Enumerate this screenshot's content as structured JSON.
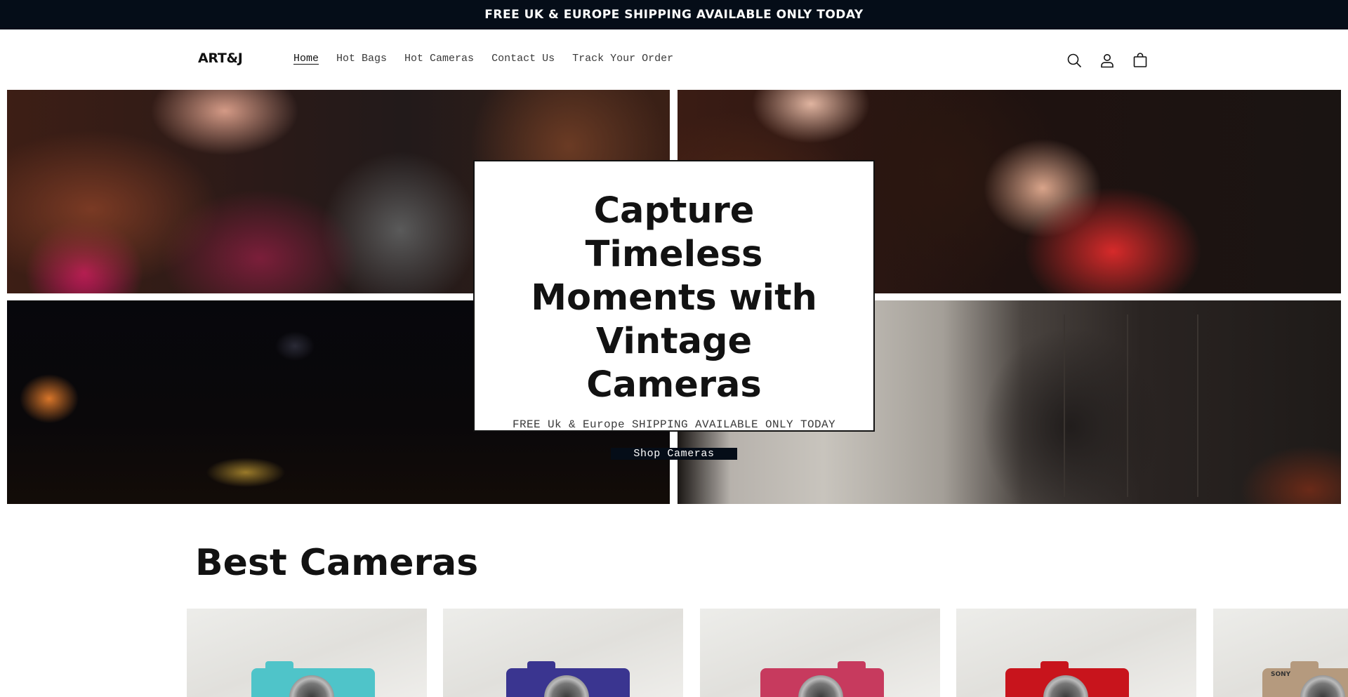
{
  "announcement": {
    "text": "FREE UK & EUROPE SHIPPING AVAILABLE ONLY TODAY"
  },
  "header": {
    "logo": "ART&J",
    "nav": [
      {
        "label": "Home",
        "active": true
      },
      {
        "label": "Hot Bags",
        "active": false
      },
      {
        "label": "Hot Cameras",
        "active": false
      },
      {
        "label": "Contact Us",
        "active": false
      },
      {
        "label": "Track Your Order",
        "active": false
      }
    ],
    "icons": [
      "search-icon",
      "account-icon",
      "cart-icon"
    ]
  },
  "hero": {
    "title": "Capture Timeless Moments with Vintage Cameras",
    "subtitle": "FREE Uk & Europe SHIPPING AVAILABLE ONLY TODAY",
    "button": "Shop Cameras"
  },
  "section": {
    "title": "Best Cameras"
  },
  "products": [
    {
      "color": "#4fc4c9"
    },
    {
      "color": "#3a3590"
    },
    {
      "color": "#c73a5e"
    },
    {
      "color": "#c8141c"
    },
    {
      "color": "#b59a7e",
      "brand": "SONY"
    }
  ],
  "colors": {
    "announcement_bg": "#050d18",
    "button_bg": "#050d18",
    "text": "#121212"
  }
}
